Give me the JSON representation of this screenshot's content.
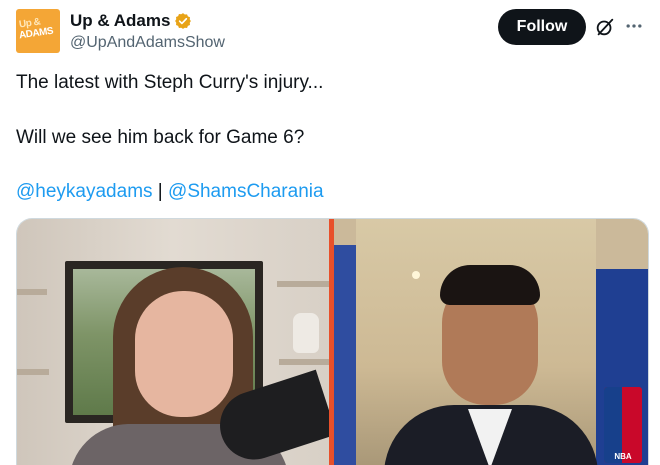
{
  "author": {
    "avatar_line1": "Up &",
    "avatar_line2": "ADAMS",
    "display_name": "Up & Adams",
    "handle": "@UpAndAdamsShow"
  },
  "actions": {
    "follow_label": "Follow"
  },
  "tweet": {
    "line1": "The latest with Steph Curry's injury...",
    "line2": "Will we see him back for Game 6?",
    "mention1": "@heykayadams",
    "separator": " | ",
    "mention2": "@ShamsCharania"
  },
  "media": {
    "nba_logo_text": "NBA"
  },
  "colors": {
    "link": "#1d9bf0",
    "verified_badge": "#e8a317",
    "follow_bg": "#0f1419"
  },
  "icons": {
    "verified": "verified-badge-icon",
    "grok": "grok-icon",
    "more": "more-icon"
  }
}
